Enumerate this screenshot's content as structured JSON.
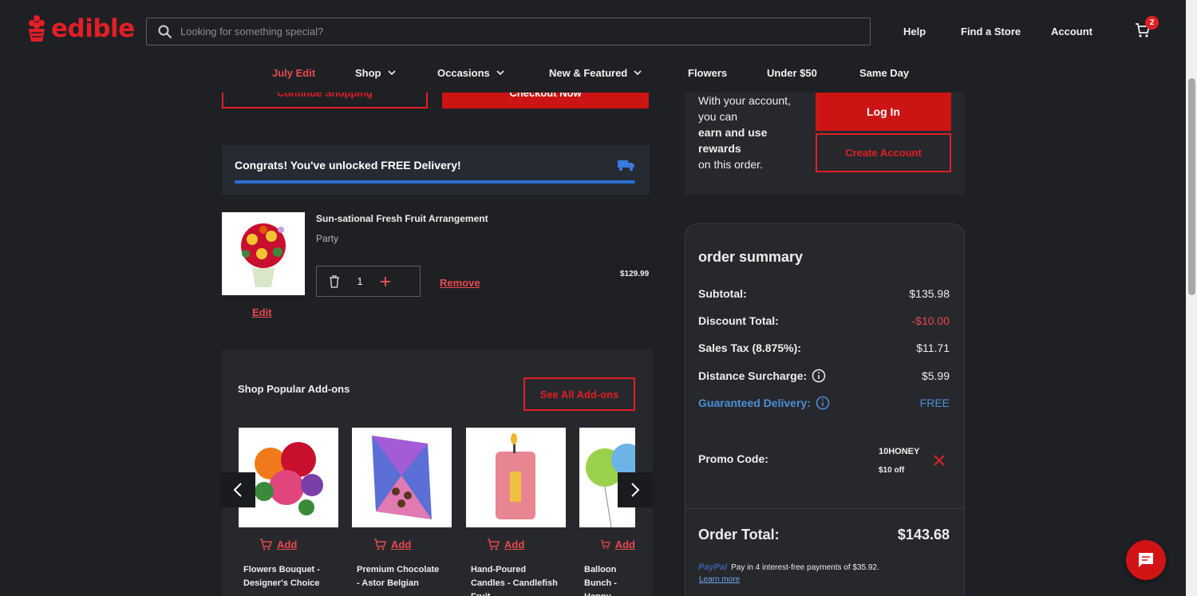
{
  "brand": {
    "name": "edible",
    "color": "#e11f26"
  },
  "search": {
    "placeholder": "Looking for something special?"
  },
  "top_links": {
    "help": "Help",
    "find_store": "Find a Store",
    "account": "Account",
    "cart_count": "2"
  },
  "nav": {
    "july_edit": "July Edit",
    "shop": "Shop",
    "occasions": "Occasions",
    "new_featured": "New & Featured",
    "flowers": "Flowers",
    "under50": "Under $50",
    "same_day": "Same Day"
  },
  "cart_actions": {
    "continue": "Continue Shopping",
    "checkout": "Checkout Now"
  },
  "delivery_banner": {
    "text": "Congrats! You've unlocked FREE Delivery!",
    "progress": 1.0
  },
  "cart_item": {
    "name": "Sun-sational Fresh Fruit Arrangement",
    "subtitle": "Party",
    "quantity": "1",
    "remove": "Remove",
    "edit": "Edit",
    "price": "$129.99"
  },
  "addons": {
    "title": "Shop Popular Add-ons",
    "see_all": "See All Add-ons",
    "add_label": "Add",
    "items": [
      {
        "name": "Flowers Bouquet - Designer's Choice"
      },
      {
        "name": "Premium Chocolate - Astor Belgian"
      },
      {
        "name": "Hand-Poured Candles - Candlefish Fruit"
      },
      {
        "name": "Balloon Bunch - Happy Birthday"
      }
    ]
  },
  "account_prompt": {
    "line1": "With your account, you can",
    "bold": "earn and use rewards",
    "line2": "on this order.",
    "login": "Log In",
    "create": "Create Account"
  },
  "summary": {
    "title": "order summary",
    "subtotal_label": "Subtotal:",
    "subtotal": "$135.98",
    "discount_label": "Discount Total:",
    "discount": "-$10.00",
    "tax_label": "Sales Tax (8.875%):",
    "tax": "$11.71",
    "surcharge_label": "Distance Surcharge:",
    "surcharge": "$5.99",
    "guaranteed_label": "Guaranteed Delivery:",
    "guaranteed": "FREE",
    "promo_label": "Promo Code:",
    "promo_code": "10HONEY",
    "promo_desc": "$10 off",
    "total_label": "Order Total:",
    "total": "$143.68",
    "paypal_brand": "PayPal",
    "paypal_text": "Pay in 4 interest-free payments of $35.92.",
    "learn_more": "Learn more"
  },
  "colors": {
    "accent_red": "#e11f26",
    "link_blue": "#4a90d9",
    "bg": "#1f2023"
  }
}
